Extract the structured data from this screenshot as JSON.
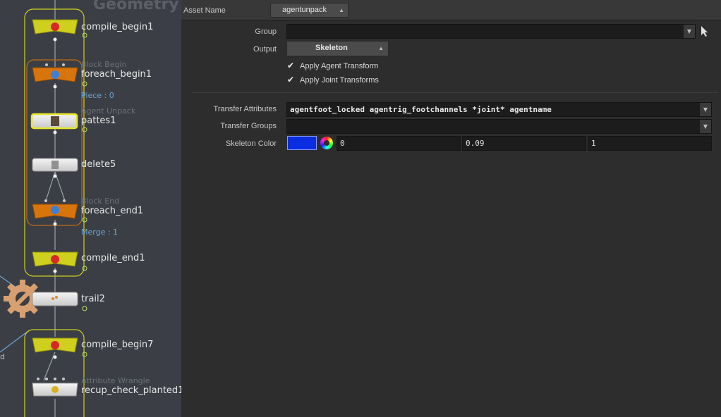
{
  "network": {
    "title": "Geometry",
    "side_char": "d",
    "nodes": [
      {
        "name": "compile_begin1",
        "type": "",
        "extra": ""
      },
      {
        "name": "foreach_begin1",
        "type": "Block Begin",
        "extra": "Piece : 0"
      },
      {
        "name": "pattes1",
        "type": "Agent Unpack",
        "extra": ""
      },
      {
        "name": "delete5",
        "type": "",
        "extra": ""
      },
      {
        "name": "foreach_end1",
        "type": "Block End",
        "extra": "Merge : 1"
      },
      {
        "name": "compile_end1",
        "type": "",
        "extra": ""
      },
      {
        "name": "trail2",
        "type": "",
        "extra": ""
      },
      {
        "name": "compile_begin7",
        "type": "",
        "extra": ""
      },
      {
        "name": "recup_check_planted1",
        "type": "Attribute Wrangle",
        "extra": ""
      }
    ]
  },
  "params": {
    "asset_name_label": "Asset Name",
    "asset_name_value": "agentunpack",
    "group_label": "Group",
    "group_value": "",
    "output_label": "Output",
    "output_value": "Skeleton",
    "apply_agent_transform": "Apply Agent Transform",
    "apply_joint_transforms": "Apply Joint Transforms",
    "transfer_attributes_label": "Transfer Attributes",
    "transfer_attributes_value": "agentfoot_locked agentrig_footchannels *joint* agentname",
    "transfer_groups_label": "Transfer Groups",
    "transfer_groups_value": "",
    "skeleton_color_label": "Skeleton Color",
    "skeleton_color_r": "0",
    "skeleton_color_g": "0.09",
    "skeleton_color_b": "1",
    "skeleton_color_hex": "#0017ff"
  },
  "colors": {
    "network_bg": "#3b3f45",
    "compile_node": "#cfcf1e",
    "foreach_node": "#d8740c",
    "selection_yellow": "#e5e52a",
    "block_orange": "#c06a14",
    "info_blue": "#6fa3d6"
  }
}
